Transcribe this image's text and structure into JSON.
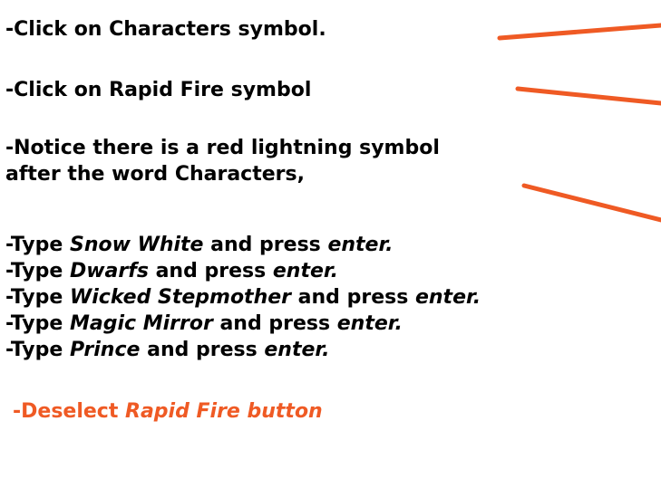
{
  "colors": {
    "text": "#000000",
    "accent": "#ef5a24",
    "background": "#ffffff"
  },
  "instructions": [
    "-Click on Characters symbol.",
    "-Click on Rapid Fire symbol",
    "-Notice there is a red lightning symbol",
    "after the word Characters,"
  ],
  "type_steps": [
    {
      "prefix": "-Type ",
      "item": "Snow White",
      "middle": " and press ",
      "key": "enter."
    },
    {
      "prefix": "-Type ",
      "item": "Dwarfs",
      "middle": " and press ",
      "key": "enter."
    },
    {
      "prefix": "-Type ",
      "item": "Wicked Stepmother",
      "middle": " and press ",
      "key": "enter."
    },
    {
      "prefix": "-Type ",
      "item": "Magic Mirror",
      "middle": " and press ",
      "key": "enter."
    },
    {
      "prefix": "-Type ",
      "item": "Prince",
      "middle": " and press ",
      "key": "enter."
    }
  ],
  "final_step": {
    "prefix": "-Deselect ",
    "item": "Rapid Fire button"
  }
}
